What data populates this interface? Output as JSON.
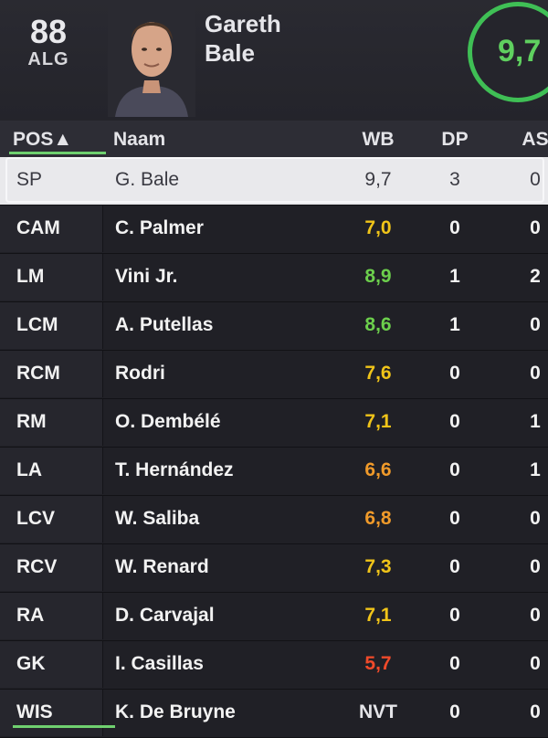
{
  "player": {
    "overall": "88",
    "position": "ALG",
    "first_name": "Gareth",
    "last_name": "Bale",
    "rating": "9,7"
  },
  "columns": {
    "pos": "POS▲",
    "name": "Naam",
    "wb": "WB",
    "dp": "DP",
    "as": "AS"
  },
  "colors": {
    "good": "#6ccf4c",
    "mid": "#f0c419",
    "orange": "#f09a2a",
    "low": "#f04a2a",
    "ring": "#3fbf55"
  },
  "rows": [
    {
      "pos": "SP",
      "name": "G. Bale",
      "wb": "9,7",
      "dp": "3",
      "as": "0",
      "wb_color": "#3a3a42"
    },
    {
      "pos": "CAM",
      "name": "C. Palmer",
      "wb": "7,0",
      "dp": "0",
      "as": "0",
      "wb_color": "#f0c419"
    },
    {
      "pos": "LM",
      "name": "Vini Jr.",
      "wb": "8,9",
      "dp": "1",
      "as": "2",
      "wb_color": "#6ccf4c"
    },
    {
      "pos": "LCM",
      "name": "A. Putellas",
      "wb": "8,6",
      "dp": "1",
      "as": "0",
      "wb_color": "#6ccf4c"
    },
    {
      "pos": "RCM",
      "name": "Rodri",
      "wb": "7,6",
      "dp": "0",
      "as": "0",
      "wb_color": "#f0c419"
    },
    {
      "pos": "RM",
      "name": "O. Dembélé",
      "wb": "7,1",
      "dp": "0",
      "as": "1",
      "wb_color": "#f0c419"
    },
    {
      "pos": "LA",
      "name": "T. Hernández",
      "wb": "6,6",
      "dp": "0",
      "as": "1",
      "wb_color": "#f09a2a"
    },
    {
      "pos": "LCV",
      "name": "W. Saliba",
      "wb": "6,8",
      "dp": "0",
      "as": "0",
      "wb_color": "#f09a2a"
    },
    {
      "pos": "RCV",
      "name": "W. Renard",
      "wb": "7,3",
      "dp": "0",
      "as": "0",
      "wb_color": "#f0c419"
    },
    {
      "pos": "RA",
      "name": "D. Carvajal",
      "wb": "7,1",
      "dp": "0",
      "as": "0",
      "wb_color": "#f0c419"
    },
    {
      "pos": "GK",
      "name": "I. Casillas",
      "wb": "5,7",
      "dp": "0",
      "as": "0",
      "wb_color": "#f04a2a"
    },
    {
      "pos": "WIS",
      "name": "K. De Bruyne",
      "wb": "NVT",
      "dp": "0",
      "as": "0",
      "wb_color": "#e4e4e8"
    }
  ]
}
